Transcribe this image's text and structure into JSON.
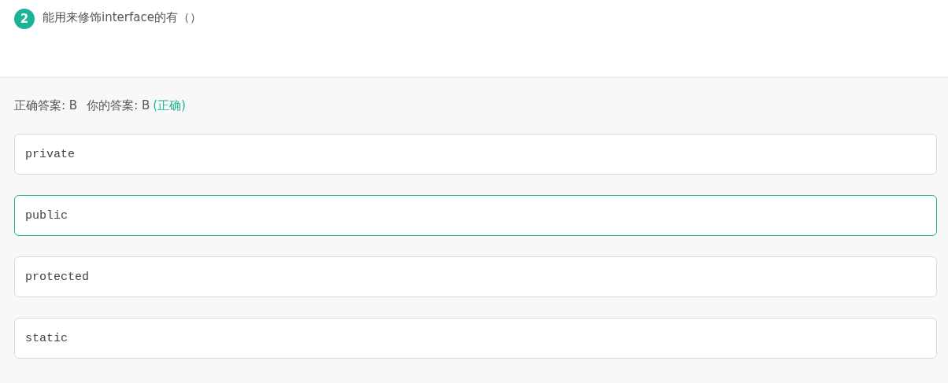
{
  "question": {
    "number": "2",
    "text": "能用来修饰interface的有（）"
  },
  "answer": {
    "correct_label": "正确答案: B",
    "your_label": "你的答案: B",
    "result": "(正确)"
  },
  "options": [
    {
      "text": "private",
      "selected": false
    },
    {
      "text": "public",
      "selected": true
    },
    {
      "text": "protected",
      "selected": false
    },
    {
      "text": "static",
      "selected": false
    }
  ]
}
